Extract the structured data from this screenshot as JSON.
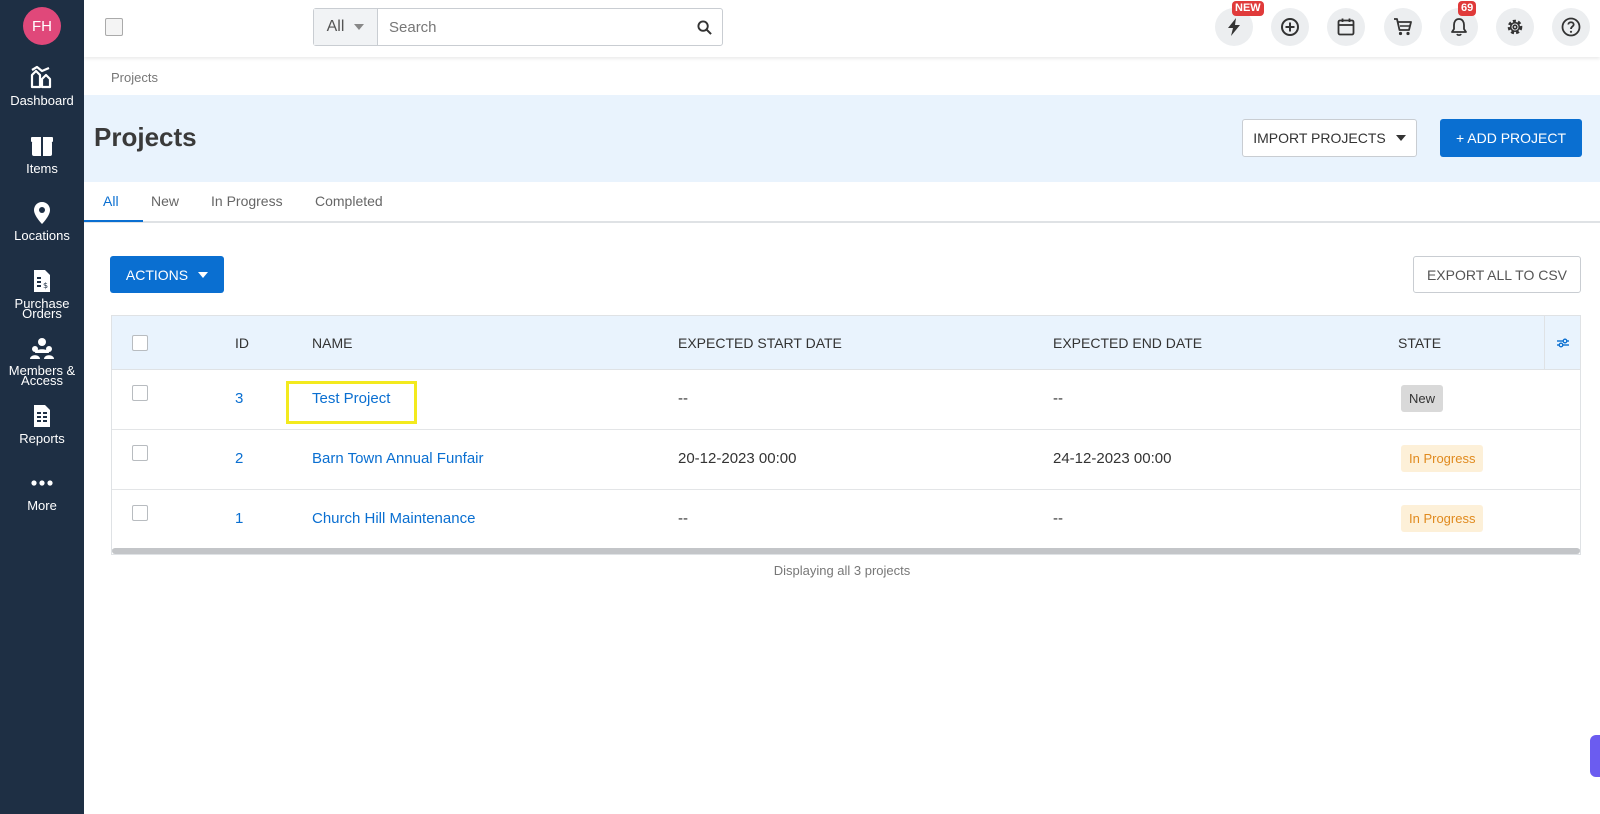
{
  "sidebar": {
    "avatar_initials": "FH",
    "items": [
      {
        "label": "Dashboard",
        "icon": "dashboard-icon"
      },
      {
        "label": "Items",
        "icon": "items-icon"
      },
      {
        "label": "Locations",
        "icon": "location-pin-icon"
      },
      {
        "label": "Purchase\nOrders",
        "icon": "purchase-orders-icon"
      },
      {
        "label": "Members &\nAccess",
        "icon": "members-icon"
      },
      {
        "label": "Reports",
        "icon": "reports-icon"
      },
      {
        "label": "More",
        "icon": "more-icon"
      }
    ]
  },
  "header": {
    "search_scope": "All",
    "search_placeholder": "Search",
    "new_badge": "NEW",
    "notification_count": "69",
    "icons": [
      "lightning-icon",
      "add-circle-icon",
      "calendar-icon",
      "cart-icon",
      "bell-icon",
      "gear-icon",
      "help-icon"
    ]
  },
  "breadcrumb": "Projects",
  "page": {
    "title": "Projects",
    "import_label": "IMPORT PROJECTS",
    "add_label": "+ ADD PROJECT"
  },
  "tabs": [
    "All",
    "New",
    "In Progress",
    "Completed"
  ],
  "active_tab": "All",
  "toolbar": {
    "actions_label": "ACTIONS",
    "export_label": "EXPORT ALL TO CSV"
  },
  "table": {
    "columns": [
      "ID",
      "NAME",
      "EXPECTED START DATE",
      "EXPECTED END DATE",
      "STATE"
    ],
    "rows": [
      {
        "id": "3",
        "name": "Test Project",
        "start": "--",
        "end": "--",
        "state": "New"
      },
      {
        "id": "2",
        "name": "Barn Town Annual Funfair",
        "start": "20-12-2023 00:00",
        "end": "24-12-2023 00:00",
        "state": "In Progress"
      },
      {
        "id": "1",
        "name": "Church Hill Maintenance",
        "start": "--",
        "end": "--",
        "state": "In Progress"
      }
    ],
    "footer": "Displaying all 3 projects"
  },
  "colors": {
    "sidebar_bg": "#1e2f44",
    "primary": "#0a6fd1",
    "state_new_bg": "#d9d9d9",
    "state_new_fg": "#333333",
    "state_progress_bg": "#fdf0d8",
    "state_progress_fg": "#e08a1e",
    "highlight": "#f3ea1e"
  }
}
